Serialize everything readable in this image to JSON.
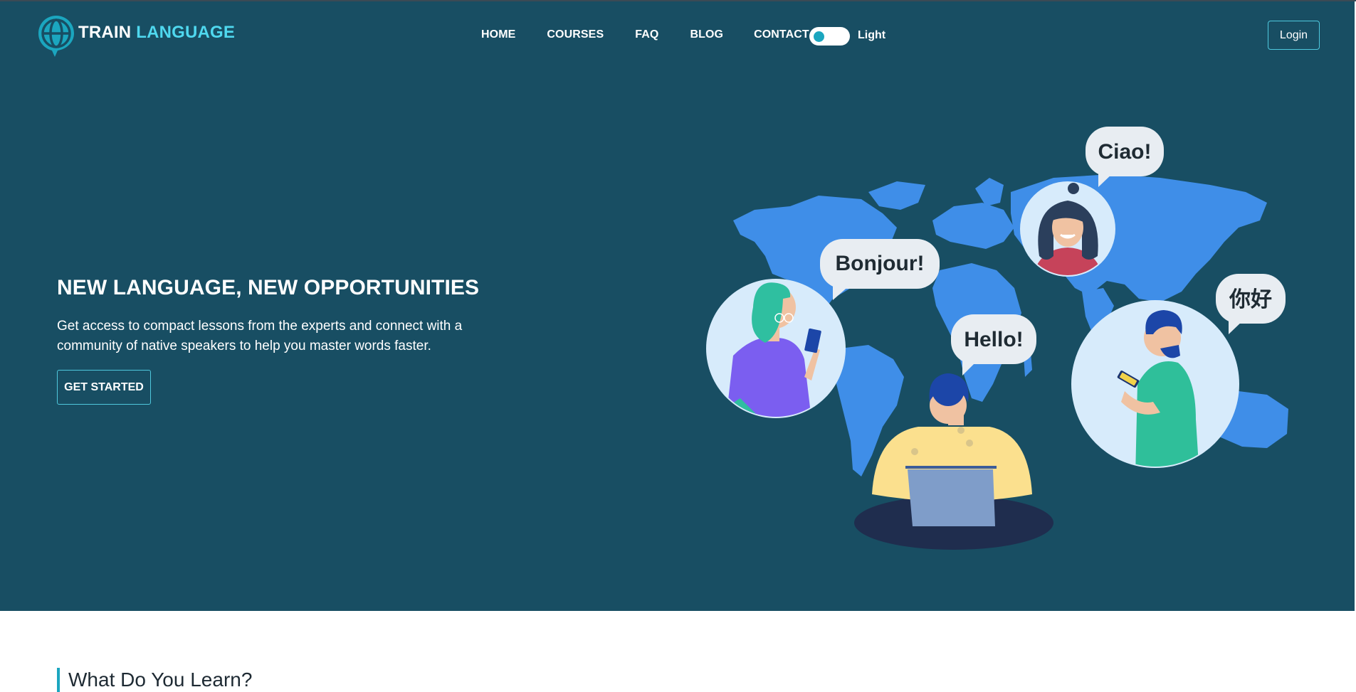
{
  "brand": {
    "name_part1": "TRAIN",
    "name_part2": "LANGUAGE",
    "icon": "globe-pin-icon",
    "accent_color": "#4fd8ef"
  },
  "nav": {
    "items": [
      {
        "label": "HOME"
      },
      {
        "label": "COURSES"
      },
      {
        "label": "FAQ"
      },
      {
        "label": "BLOG"
      },
      {
        "label": "CONTACT"
      }
    ],
    "theme_toggle_label": "Light",
    "login_label": "Login"
  },
  "hero": {
    "title": "NEW LANGUAGE, NEW OPPORTUNITIES",
    "description": "Get access to compact lessons from the experts and connect with a community of native speakers to help you master words faster.",
    "cta_label": "GET STARTED",
    "background_color": "#184e63",
    "bubbles": {
      "bonjour": "Bonjour!",
      "ciao": "Ciao!",
      "hello": "Hello!",
      "nihao": "你好"
    }
  },
  "section": {
    "title": "What Do You Learn?"
  }
}
